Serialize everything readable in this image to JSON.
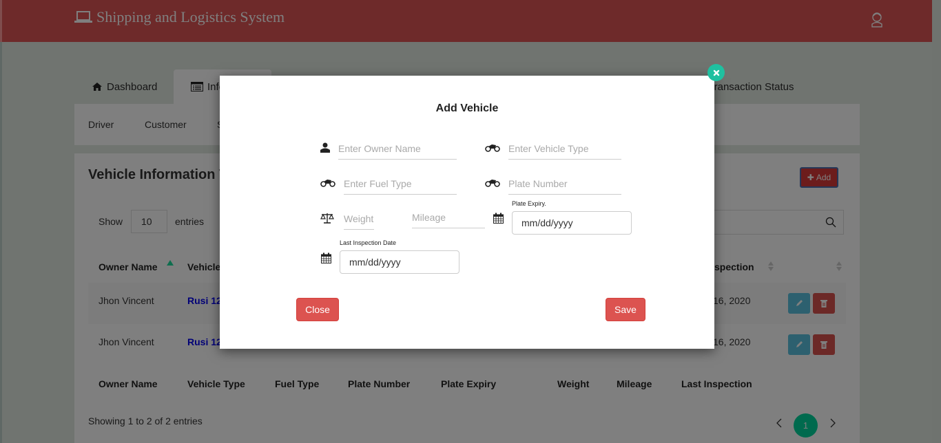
{
  "app": {
    "title": "Shipping and Logistics System",
    "logo_icon": "laptop-icon",
    "user_icon": "user-avatar-icon",
    "colors": {
      "header": "#dd5454",
      "accent": "#1fc0a0",
      "danger": "#d9534f",
      "info": "#5bc0de",
      "pagination": "#00d49c"
    }
  },
  "nav": {
    "tabs": [
      {
        "label": "Dashboard",
        "icon": "home-icon",
        "active": false
      },
      {
        "label": "Information",
        "icon": "list-alt-icon",
        "active": true
      },
      {
        "label": "Transaction Status",
        "active": false
      }
    ],
    "subnav": [
      "Driver",
      "Customer",
      "S"
    ]
  },
  "card": {
    "title": "Vehicle Information T",
    "add_label": "Add",
    "show_label": "Show",
    "entries_value": "10",
    "entries_label": "entries",
    "search_value": "",
    "columns": [
      "Owner Name",
      "Vehicle Type",
      "Fuel Type",
      "Plate Number",
      "Plate Expiry",
      "Weight",
      "Mileage",
      "Last Inspection"
    ],
    "header_visible": {
      "owner": "Owner Name",
      "vehicle": "Vehicle",
      "inspection": "spection"
    },
    "rows": [
      {
        "owner": "Jhon Vincent",
        "vehicle": "Rusi 12",
        "last_inspection": "16, 2020"
      },
      {
        "owner": "Jhon Vincent",
        "vehicle": "Rusi 12",
        "last_inspection": "16, 2020"
      }
    ],
    "info": "Showing 1 to 2 of 2 entries",
    "pagination": {
      "current": "1"
    }
  },
  "modal": {
    "title": "Add Vehicle",
    "fields": {
      "owner_name": {
        "placeholder": "Enter Owner Name",
        "value": ""
      },
      "vehicle_type": {
        "placeholder": "Enter Vehicle Type",
        "value": ""
      },
      "fuel_type": {
        "placeholder": "Enter Fuel Type",
        "value": ""
      },
      "plate_number": {
        "placeholder": "Plate Number",
        "value": ""
      },
      "weight": {
        "placeholder": "Weight",
        "value": ""
      },
      "mileage": {
        "placeholder": "Mileage",
        "value": ""
      },
      "plate_expiry": {
        "label": "Plate Expiry.",
        "value": "mm/dd/yyyy"
      },
      "last_inspection": {
        "label": "Last Inspection Date",
        "value": "mm/dd/yyyy"
      }
    },
    "close_label": "Close",
    "save_label": "Save"
  }
}
